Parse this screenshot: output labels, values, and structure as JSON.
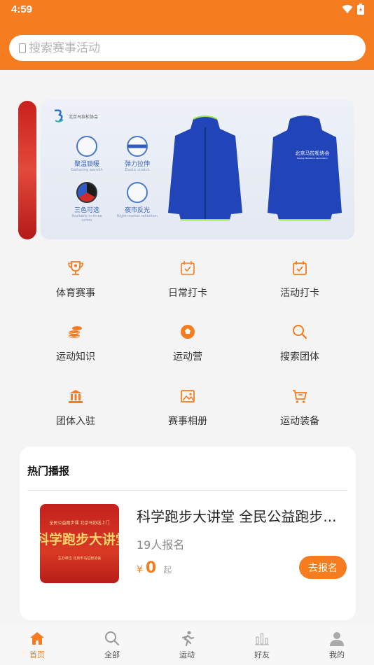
{
  "status": {
    "time": "4:59"
  },
  "search": {
    "placeholder": "搜索赛事活动"
  },
  "banner": {
    "logo_text": "北京马拉松协会",
    "features": [
      {
        "title": "聚温锁暖",
        "sub": "Gathering warmth"
      },
      {
        "title": "弹力拉伸",
        "sub": "Elastic stretch"
      },
      {
        "title": "三色可选",
        "sub": "Available in three colors"
      },
      {
        "title": "夜市反光",
        "sub": "Night market reflection"
      }
    ],
    "jacket_print": "北京马拉松协会",
    "jacket_print_sub": "Beijing Marathon Association"
  },
  "menu": [
    {
      "label": "体育赛事",
      "icon": "trophy-icon"
    },
    {
      "label": "日常打卡",
      "icon": "calendar-check-icon"
    },
    {
      "label": "活动打卡",
      "icon": "calendar-check-icon"
    },
    {
      "label": "运动知识",
      "icon": "coins-stack-icon"
    },
    {
      "label": "运动营",
      "icon": "football-icon"
    },
    {
      "label": "搜索团体",
      "icon": "search-icon"
    },
    {
      "label": "团体入驻",
      "icon": "building-icon"
    },
    {
      "label": "赛事相册",
      "icon": "image-icon"
    },
    {
      "label": "运动装备",
      "icon": "cart-icon"
    }
  ],
  "hot": {
    "title": "热门播报",
    "event": {
      "poster_top": "全民公益跑步课 北京马协送上门",
      "poster_main": "科学跑步大讲堂",
      "poster_sub": "主办单位 北京市马拉松协会",
      "title": "科学跑步大讲堂 全民公益跑步...",
      "count": "19人报名",
      "currency": "¥",
      "price": "0",
      "from": "起",
      "button": "去报名"
    }
  },
  "tabbar": [
    {
      "label": "首页",
      "icon": "home-icon",
      "active": true
    },
    {
      "label": "全部",
      "icon": "search-icon",
      "active": false
    },
    {
      "label": "运动",
      "icon": "runner-icon",
      "active": false
    },
    {
      "label": "好友",
      "icon": "bar-chart-icon",
      "active": false
    },
    {
      "label": "我的",
      "icon": "person-icon",
      "active": false
    }
  ],
  "colors": {
    "accent": "#f57c1f",
    "background": "#f4f4f4"
  }
}
